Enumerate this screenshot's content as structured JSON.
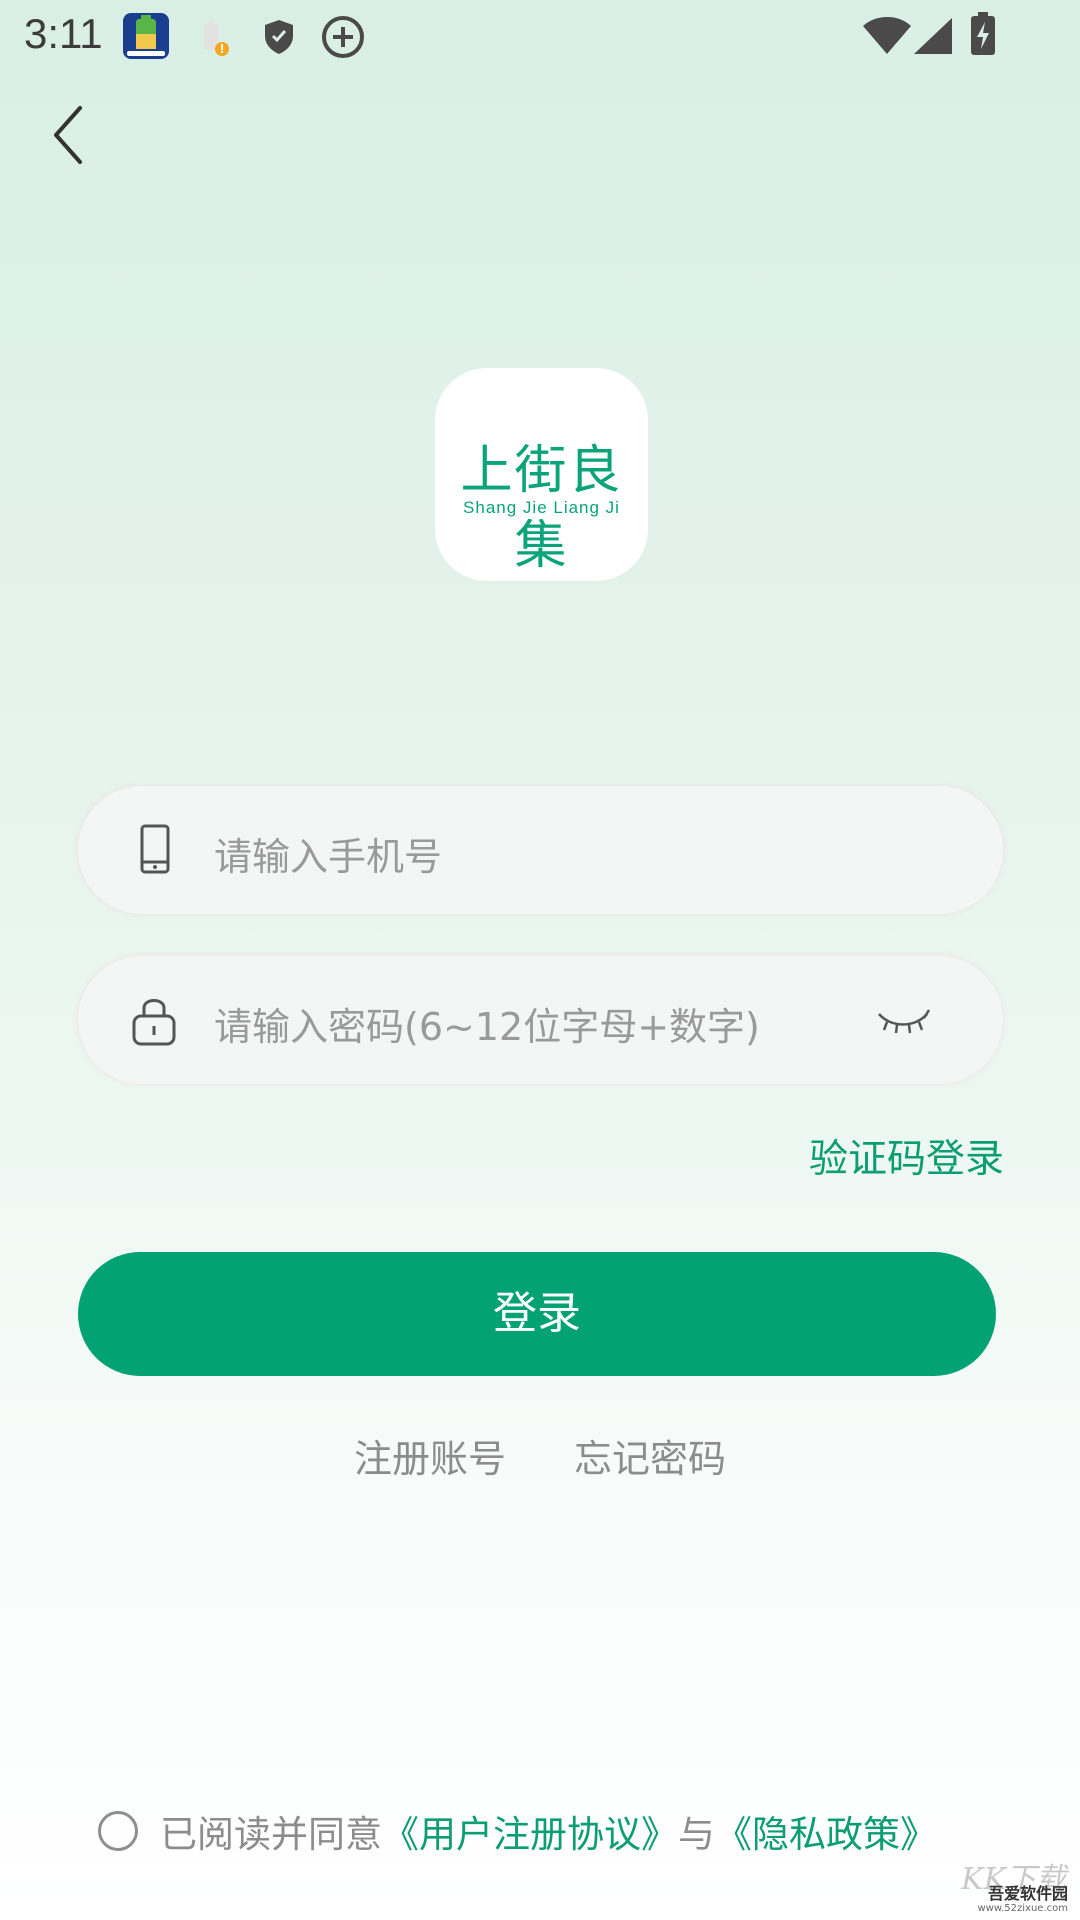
{
  "status_bar": {
    "time": "3:11",
    "icons": [
      "app-notification-icon",
      "battery-alert-icon",
      "shield-icon",
      "add-circle-icon",
      "wifi-icon",
      "signal-icon",
      "battery-charging-icon"
    ]
  },
  "nav": {
    "back_icon": "chevron-left-icon"
  },
  "logo": {
    "title_cn": "上街良集",
    "title_en": "Shang Jie Liang Ji"
  },
  "form": {
    "phone_placeholder": "请输入手机号",
    "password_placeholder": "请输入密码(6~12位字母+数字)",
    "sms_login_link": "验证码登录",
    "login_button": "登录",
    "register_link": "注册账号",
    "forgot_link": "忘记密码"
  },
  "agreement": {
    "prefix": "已阅读并同意",
    "user_agreement": "《用户注册协议》",
    "connector": "与",
    "privacy_policy": "《隐私政策》"
  },
  "watermark": {
    "top": "KK下载",
    "brand": "吾爱软件园",
    "url": "www.52zixue.com"
  },
  "colors": {
    "accent": "#02a274",
    "link": "#0c9d72",
    "placeholder": "#9a9a9a"
  }
}
